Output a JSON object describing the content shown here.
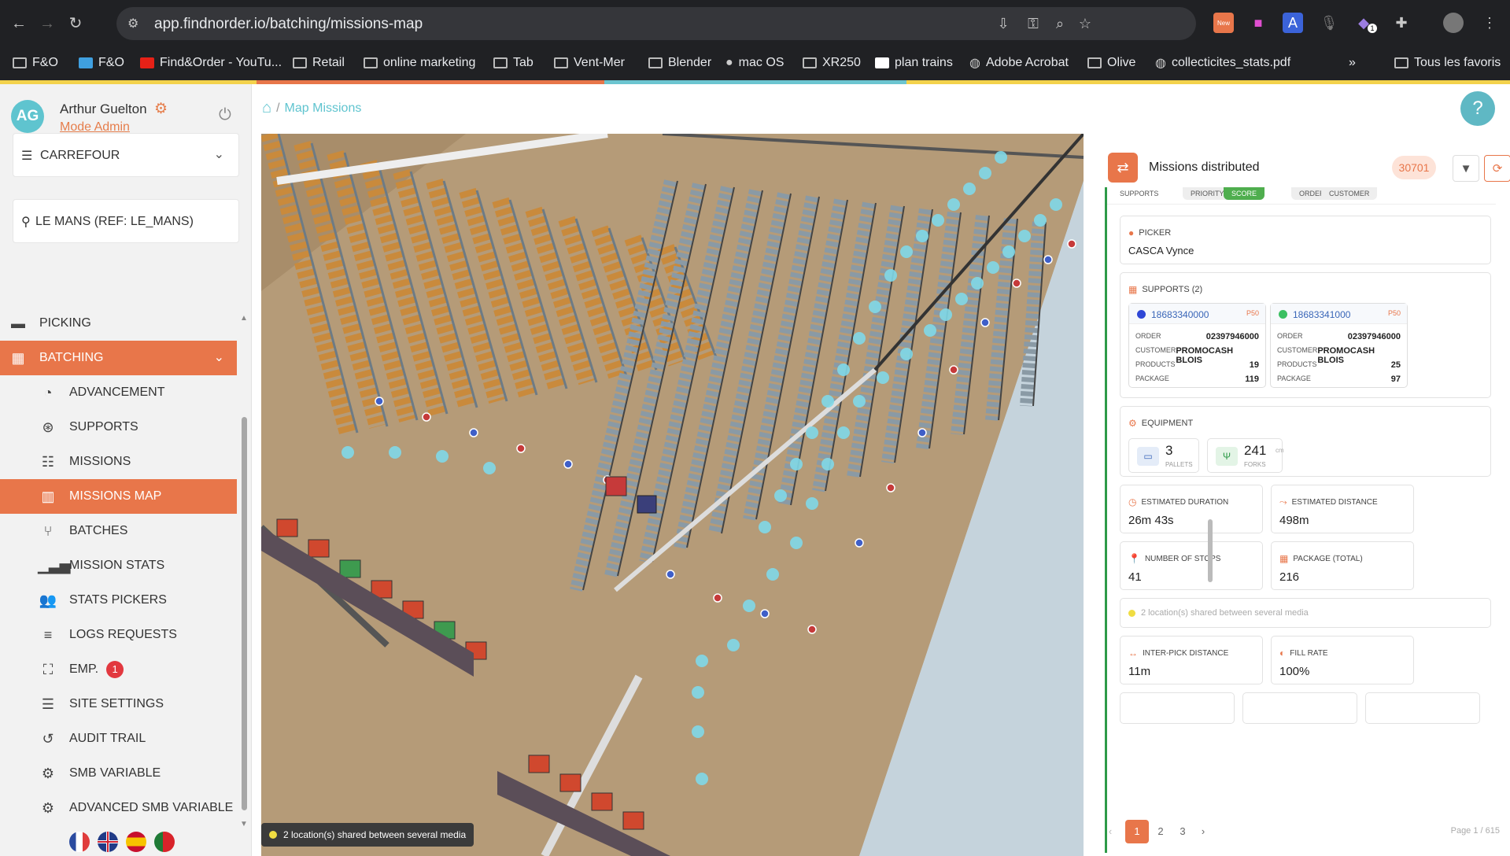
{
  "browser": {
    "url": "app.findnorder.io/batching/missions-map",
    "new_badge": "New",
    "ext_count": "1",
    "bookmarks": [
      "F&O",
      "F&O",
      "Find&Order - YouTu...",
      "Retail",
      "online marketing",
      "Tab",
      "Vent-Mer",
      "Blender",
      "mac OS",
      "XR250",
      "plan trains",
      "Adobe Acrobat",
      "Olive",
      "collecticites_stats.pdf"
    ],
    "all_bookmarks": "Tous les favoris",
    "more": "»"
  },
  "user": {
    "initials": "AG",
    "name": "Arthur Guelton",
    "mode": "Mode Admin"
  },
  "selectors": {
    "client": "CARREFOUR",
    "site": "LE MANS (REF: LE_MANS)"
  },
  "menu": {
    "picking": "PICKING",
    "batching": "BATCHING",
    "items": [
      {
        "label": "ADVANCEMENT",
        "icon": "gauge-icon"
      },
      {
        "label": "SUPPORTS",
        "icon": "support-icon"
      },
      {
        "label": "MISSIONS",
        "icon": "list-icon"
      },
      {
        "label": "MISSIONS MAP",
        "icon": "map-icon"
      },
      {
        "label": "BATCHES",
        "icon": "branch-icon"
      },
      {
        "label": "MISSION STATS",
        "icon": "bar-chart-icon"
      },
      {
        "label": "STATS PICKERS",
        "icon": "users-icon"
      },
      {
        "label": "LOGS REQUESTS",
        "icon": "log-icon"
      },
      {
        "label": "EMP.",
        "icon": "map-marker-icon",
        "badge": "1"
      },
      {
        "label": "SITE SETTINGS",
        "icon": "sliders-icon"
      },
      {
        "label": "AUDIT TRAIL",
        "icon": "history-icon"
      },
      {
        "label": "SMB VARIABLE",
        "icon": "cogs-icon"
      },
      {
        "label": "ADVANCED SMB VARIABLE",
        "icon": "cogs-icon"
      }
    ]
  },
  "breadcrumb": {
    "sep": "/",
    "page": "Map Missions"
  },
  "help": "?",
  "map_note": "2 location(s) shared between several media",
  "panel": {
    "title": "Missions distributed",
    "count": "30701",
    "chips": [
      "SUPPORTS",
      "PRIORITY",
      "SCORE",
      "ORDER",
      "CUSTOMER"
    ],
    "picker_label": "PICKER",
    "picker": "CASCA Vynce",
    "supports_label": "SUPPORTS (2)",
    "supports": [
      {
        "id": "18683340000",
        "tag": "P50",
        "color": "#2f47d6",
        "order": "02397946000",
        "customer": "PROMOCASH BLOIS",
        "products": "19",
        "package": "119"
      },
      {
        "id": "18683341000",
        "tag": "P50",
        "color": "#3cc062",
        "order": "02397946000",
        "customer": "PROMOCASH BLOIS",
        "products": "25",
        "package": "97"
      }
    ],
    "support_fields": {
      "order": "ORDER",
      "customer": "CUSTOMER",
      "products": "PRODUCTS",
      "package": "PACKAGE"
    },
    "equipment_label": "EQUIPMENT",
    "pallets": {
      "value": "3",
      "unit": "PALLETS"
    },
    "forks": {
      "value": "241",
      "unit": "FORKS",
      "suffix": "cm"
    },
    "duration": {
      "label": "ESTIMATED DURATION",
      "value": "26m 43s"
    },
    "distance": {
      "label": "ESTIMATED DISTANCE",
      "value": "498m"
    },
    "stops": {
      "label": "NUMBER OF STOPS",
      "value": "41"
    },
    "package_total": {
      "label": "PACKAGE (TOTAL)",
      "value": "216"
    },
    "shared_note": "2 location(s) shared between several media",
    "interpick": {
      "label": "INTER-PICK DISTANCE",
      "value": "11m"
    },
    "fill_rate": {
      "label": "FILL RATE",
      "value": "100%"
    }
  },
  "pager": {
    "prev": "‹",
    "pages": [
      "1",
      "2",
      "3"
    ],
    "next": "›",
    "info": "Page 1 / 615"
  },
  "colors": {
    "accent": "#e8764a",
    "teal": "#5fc4cf",
    "green": "#2e9a48",
    "floor": "#b59b78"
  }
}
